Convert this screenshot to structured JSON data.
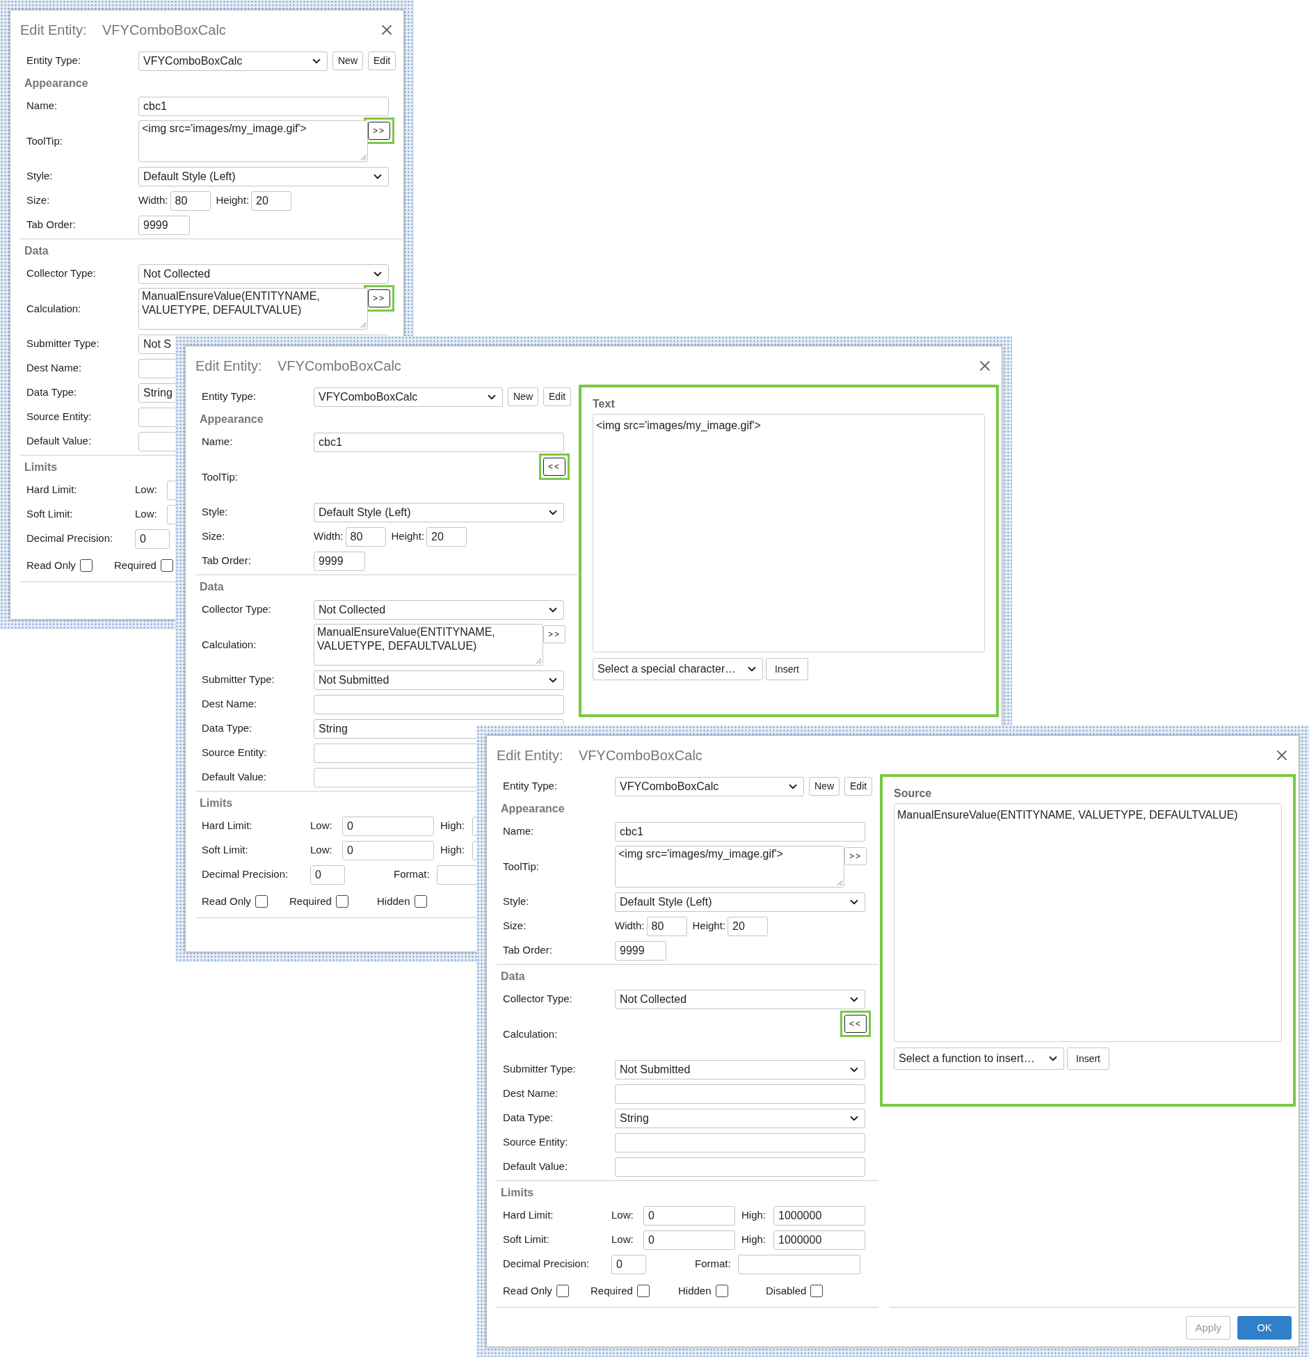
{
  "dialogs": [
    {
      "title_label": "Edit Entity:",
      "title": "VFYComboBoxCalc",
      "entity_type": {
        "label": "Entity Type:",
        "value": "VFYComboBoxCalc",
        "buttons": [
          "New",
          "Edit"
        ]
      },
      "sections": [
        {
          "heading": "Appearance",
          "rows": [
            {
              "kind": "input",
              "label": "Name:",
              "value": "cbc1"
            },
            {
              "kind": "textarea",
              "label": "ToolTip:",
              "value": "<img src='images/my_image.gif'>",
              "popped_out": false,
              "button": {
                "label": ">>",
                "highlighted": true
              }
            },
            {
              "kind": "select",
              "label": "Style:",
              "value": "Default Style (Left)"
            },
            {
              "kind": "size",
              "label": "Size:",
              "fields": [
                {
                  "label": "Width:",
                  "value": "80"
                },
                {
                  "label": "Height:",
                  "value": "20"
                }
              ]
            },
            {
              "kind": "short",
              "label": "Tab Order:",
              "value": "9999"
            }
          ]
        },
        {
          "heading": "Data",
          "rows": [
            {
              "kind": "select",
              "label": "Collector Type:",
              "value": "Not Collected"
            },
            {
              "kind": "textarea",
              "label": "Calculation:",
              "value": "ManualEnsureValue(ENTITYNAME, VALUETYPE, DEFAULTVALUE)",
              "popped_out": false,
              "button": {
                "label": ">>",
                "highlighted": true
              }
            },
            {
              "kind": "select",
              "label": "Submitter Type:",
              "value": "Not S"
            },
            {
              "kind": "input",
              "label": "Dest Name:"
            },
            {
              "kind": "select",
              "label": "Data Type:",
              "value": "String"
            },
            {
              "kind": "input",
              "label": "Source Entity:"
            },
            {
              "kind": "input",
              "label": "Default Value:"
            }
          ]
        },
        {
          "heading": "Limits",
          "rows": [
            {
              "kind": "range",
              "label": "Hard Limit:",
              "fields": [
                {
                  "label": "Low:"
                }
              ]
            },
            {
              "kind": "range",
              "label": "Soft Limit:",
              "fields": [
                {
                  "label": "Low:"
                }
              ]
            },
            {
              "kind": "pair",
              "label": "Decimal Precision:",
              "value": "0",
              "fields": []
            },
            {
              "kind": "checks",
              "items": [
                {
                  "label": "Read Only",
                  "checked": false
                },
                {
                  "label": "Required",
                  "checked": false
                }
              ]
            }
          ]
        }
      ]
    },
    {
      "title_label": "Edit Entity:",
      "title": "VFYComboBoxCalc",
      "entity_type": {
        "label": "Entity Type:",
        "value": "VFYComboBoxCalc",
        "buttons": [
          "New",
          "Edit"
        ]
      },
      "sections": [
        {
          "heading": "Appearance",
          "rows": [
            {
              "kind": "input",
              "label": "Name:",
              "value": "cbc1"
            },
            {
              "kind": "textarea",
              "label": "ToolTip:",
              "popped_out": true,
              "button": {
                "label": "<<",
                "highlighted": true
              }
            },
            {
              "kind": "select",
              "label": "Style:",
              "value": "Default Style (Left)"
            },
            {
              "kind": "size",
              "label": "Size:",
              "fields": [
                {
                  "label": "Width:",
                  "value": "80"
                },
                {
                  "label": "Height:",
                  "value": "20"
                }
              ]
            },
            {
              "kind": "short",
              "label": "Tab Order:",
              "value": "9999"
            }
          ]
        },
        {
          "heading": "Data",
          "rows": [
            {
              "kind": "select",
              "label": "Collector Type:",
              "value": "Not Collected"
            },
            {
              "kind": "textarea",
              "label": "Calculation:",
              "value": "ManualEnsureValue(ENTITYNAME, VALUETYPE, DEFAULTVALUE)",
              "popped_out": false,
              "button": {
                "label": ">>",
                "highlighted": false
              }
            },
            {
              "kind": "select",
              "label": "Submitter Type:",
              "value": "Not Submitted"
            },
            {
              "kind": "input",
              "label": "Dest Name:"
            },
            {
              "kind": "select",
              "label": "Data Type:",
              "value": "String"
            },
            {
              "kind": "input",
              "label": "Source Entity:"
            },
            {
              "kind": "input",
              "label": "Default Value:"
            }
          ]
        },
        {
          "heading": "Limits",
          "rows": [
            {
              "kind": "range",
              "label": "Hard Limit:",
              "fields": [
                {
                  "label": "Low:",
                  "value": "0"
                },
                {
                  "label": "High:"
                }
              ]
            },
            {
              "kind": "range",
              "label": "Soft Limit:",
              "fields": [
                {
                  "label": "Low:",
                  "value": "0"
                },
                {
                  "label": "High:"
                }
              ]
            },
            {
              "kind": "pair",
              "label": "Decimal Precision:",
              "value": "0",
              "fields": [
                {
                  "label": "Format:"
                }
              ]
            },
            {
              "kind": "checks",
              "items": [
                {
                  "label": "Read Only",
                  "checked": false
                },
                {
                  "label": "Required",
                  "checked": false
                },
                {
                  "label": "Hidden",
                  "checked": false
                }
              ]
            }
          ]
        }
      ],
      "side_panel": {
        "title": "Text",
        "value": "<img src='images/my_image.gif'>",
        "highlighted": true,
        "picker": "Select a special character…",
        "insert_button": "Insert"
      }
    },
    {
      "title_label": "Edit Entity:",
      "title": "VFYComboBoxCalc",
      "entity_type": {
        "label": "Entity Type:",
        "value": "VFYComboBoxCalc",
        "buttons": [
          "New",
          "Edit"
        ]
      },
      "sections": [
        {
          "heading": "Appearance",
          "rows": [
            {
              "kind": "input",
              "label": "Name:",
              "value": "cbc1"
            },
            {
              "kind": "textarea",
              "label": "ToolTip:",
              "value": "<img src='images/my_image.gif'>",
              "popped_out": false,
              "button": {
                "label": ">>",
                "highlighted": false
              }
            },
            {
              "kind": "select",
              "label": "Style:",
              "value": "Default Style (Left)"
            },
            {
              "kind": "size",
              "label": "Size:",
              "fields": [
                {
                  "label": "Width:",
                  "value": "80"
                },
                {
                  "label": "Height:",
                  "value": "20"
                }
              ]
            },
            {
              "kind": "short",
              "label": "Tab Order:",
              "value": "9999"
            }
          ]
        },
        {
          "heading": "Data",
          "rows": [
            {
              "kind": "select",
              "label": "Collector Type:",
              "value": "Not Collected"
            },
            {
              "kind": "textarea",
              "label": "Calculation:",
              "popped_out": true,
              "button": {
                "label": "<<",
                "highlighted": true
              }
            },
            {
              "kind": "select",
              "label": "Submitter Type:",
              "value": "Not Submitted"
            },
            {
              "kind": "input",
              "label": "Dest Name:"
            },
            {
              "kind": "select",
              "label": "Data Type:",
              "value": "String"
            },
            {
              "kind": "input",
              "label": "Source Entity:"
            },
            {
              "kind": "input",
              "label": "Default Value:"
            }
          ]
        },
        {
          "heading": "Limits",
          "rows": [
            {
              "kind": "range",
              "label": "Hard Limit:",
              "fields": [
                {
                  "label": "Low:",
                  "value": "0"
                },
                {
                  "label": "High:",
                  "value": "1000000"
                }
              ]
            },
            {
              "kind": "range",
              "label": "Soft Limit:",
              "fields": [
                {
                  "label": "Low:",
                  "value": "0"
                },
                {
                  "label": "High:",
                  "value": "1000000"
                }
              ]
            },
            {
              "kind": "pair",
              "label": "Decimal Precision:",
              "value": "0",
              "fields": [
                {
                  "label": "Format:"
                }
              ]
            },
            {
              "kind": "checks",
              "items": [
                {
                  "label": "Read Only",
                  "checked": false
                },
                {
                  "label": "Required",
                  "checked": false
                },
                {
                  "label": "Hidden",
                  "checked": false
                },
                {
                  "label": "Disabled",
                  "checked": false
                }
              ]
            }
          ]
        }
      ],
      "side_panel": {
        "title": "Source",
        "value": "ManualEnsureValue(ENTITYNAME, VALUETYPE, DEFAULTVALUE)",
        "highlighted": true,
        "picker": "Select a function to insert…",
        "insert_button": "Insert"
      },
      "footer": {
        "buttons": [
          {
            "label": "Apply",
            "disabled": true,
            "primary": false
          },
          {
            "label": "OK",
            "disabled": false,
            "primary": true
          }
        ]
      }
    }
  ]
}
